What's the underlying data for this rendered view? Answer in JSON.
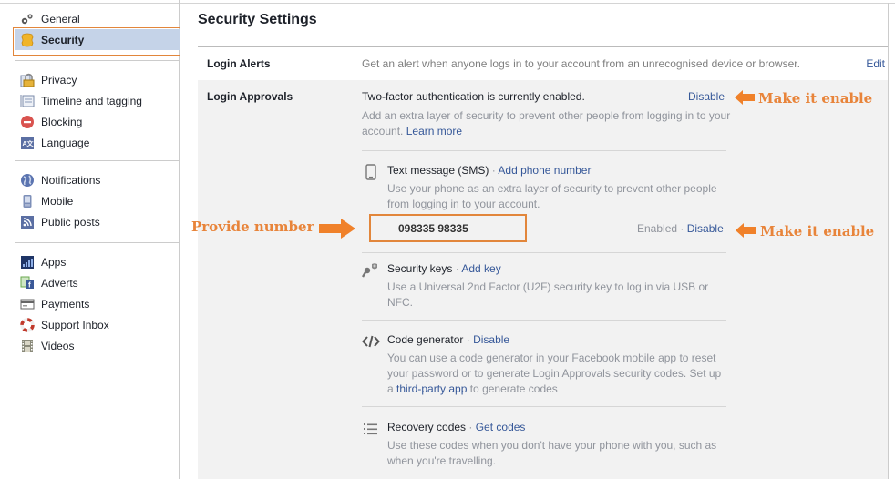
{
  "sidebar": {
    "groups": [
      {
        "items": [
          {
            "label": "General",
            "icon": "gears-icon"
          },
          {
            "label": "Security",
            "icon": "security-badge-icon",
            "active": true
          }
        ]
      },
      {
        "items": [
          {
            "label": "Privacy",
            "icon": "padlock-icon"
          },
          {
            "label": "Timeline and tagging",
            "icon": "timeline-icon"
          },
          {
            "label": "Blocking",
            "icon": "blocking-icon"
          },
          {
            "label": "Language",
            "icon": "language-icon"
          }
        ]
      },
      {
        "items": [
          {
            "label": "Notifications",
            "icon": "globe-icon"
          },
          {
            "label": "Mobile",
            "icon": "mobile-phone-icon"
          },
          {
            "label": "Public posts",
            "icon": "rss-icon"
          }
        ]
      },
      {
        "items": [
          {
            "label": "Apps",
            "icon": "apps-icon"
          },
          {
            "label": "Adverts",
            "icon": "adverts-icon"
          },
          {
            "label": "Payments",
            "icon": "credit-card-icon"
          },
          {
            "label": "Support Inbox",
            "icon": "lifebuoy-icon"
          },
          {
            "label": "Videos",
            "icon": "film-icon"
          }
        ]
      }
    ]
  },
  "main": {
    "title": "Security Settings",
    "login_alerts": {
      "label": "Login Alerts",
      "description": "Get an alert when anyone logs in to your account from an unrecognised device or browser.",
      "action": "Edit"
    },
    "login_approvals": {
      "label": "Login Approvals",
      "status": "Two-factor authentication is currently enabled.",
      "status_action": "Disable",
      "description": "Add an extra layer of security to prevent other people from logging in to your account.",
      "learn_more": "Learn more",
      "methods": [
        {
          "title": "Text message (SMS)",
          "separator": " · ",
          "action": "Add phone number",
          "description": "Use your phone as an extra layer of security to prevent other people from logging in to your account.",
          "phone_number": "098335 98335",
          "phone_status": "Enabled",
          "phone_action": "Disable"
        },
        {
          "title": "Security keys",
          "separator": " · ",
          "action": "Add key",
          "description": "Use a Universal 2nd Factor (U2F) security key to log in via USB or NFC."
        },
        {
          "title": "Code generator",
          "separator": " · ",
          "action": "Disable",
          "description_prefix": "You can use a code generator in your Facebook mobile app to reset your password or to generate Login Approvals security codes. Set up a ",
          "description_link": "third-party app",
          "description_suffix": " to generate codes"
        },
        {
          "title": "Recovery codes",
          "separator": " · ",
          "action": "Get codes",
          "description": "Use these codes when you don't have your phone with you, such as when you're travelling."
        }
      ]
    }
  },
  "annotations": {
    "top_right": "Make it enable",
    "sms_right": "Make it enable",
    "provide_number": "Provide number",
    "color": "#e8843a"
  }
}
